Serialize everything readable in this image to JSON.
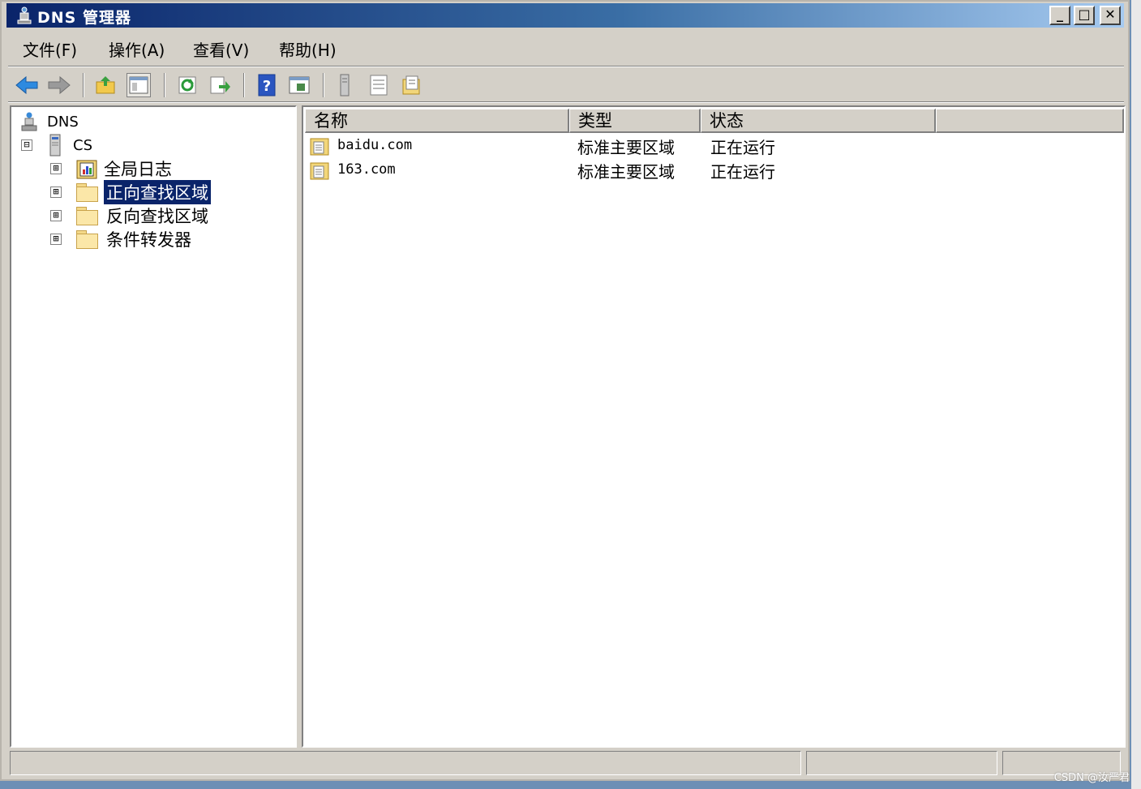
{
  "window": {
    "title": "DNS 管理器",
    "buttons": {
      "minimize": "_",
      "maximize": "□",
      "close": "✕"
    }
  },
  "menubar": {
    "items": [
      {
        "label": "文件(F)"
      },
      {
        "label": "操作(A)"
      },
      {
        "label": "查看(V)"
      },
      {
        "label": "帮助(H)"
      }
    ]
  },
  "toolbar": {
    "buttons": [
      "back-arrow-icon",
      "forward-arrow-icon",
      "up-folder-icon",
      "show-hide-console-tree-icon",
      "refresh-icon",
      "export-list-icon",
      "help-icon",
      "console-view-icon",
      "server-icon",
      "list-view-icon",
      "properties-icon"
    ]
  },
  "tree": {
    "root": {
      "label": "DNS",
      "icon": "dns-server-icon"
    },
    "server": {
      "label": "CS",
      "expander": "⊟",
      "icon": "server-tower-icon"
    },
    "children": [
      {
        "label": "全局日志",
        "expander": "⊞",
        "icon": "event-log-icon",
        "selected": false
      },
      {
        "label": "正向查找区域",
        "expander": "⊞",
        "icon": "folder-icon",
        "selected": true
      },
      {
        "label": "反向查找区域",
        "expander": "⊞",
        "icon": "folder-icon",
        "selected": false
      },
      {
        "label": "条件转发器",
        "expander": "⊞",
        "icon": "folder-icon",
        "selected": false
      }
    ]
  },
  "list": {
    "columns": [
      "名称",
      "类型",
      "状态"
    ],
    "rows": [
      {
        "name": "baidu.com",
        "type": "标准主要区域",
        "status": "正在运行",
        "icon": "zone-file-icon"
      },
      {
        "name": "163.com",
        "type": "标准主要区域",
        "status": "正在运行",
        "icon": "zone-file-icon"
      }
    ]
  },
  "watermark": "CSDN @汝严君",
  "colors": {
    "titlebar_start": "#0a246a",
    "titlebar_end": "#a6caf0",
    "selection": "#0a246a",
    "chrome": "#d4d0c8"
  }
}
